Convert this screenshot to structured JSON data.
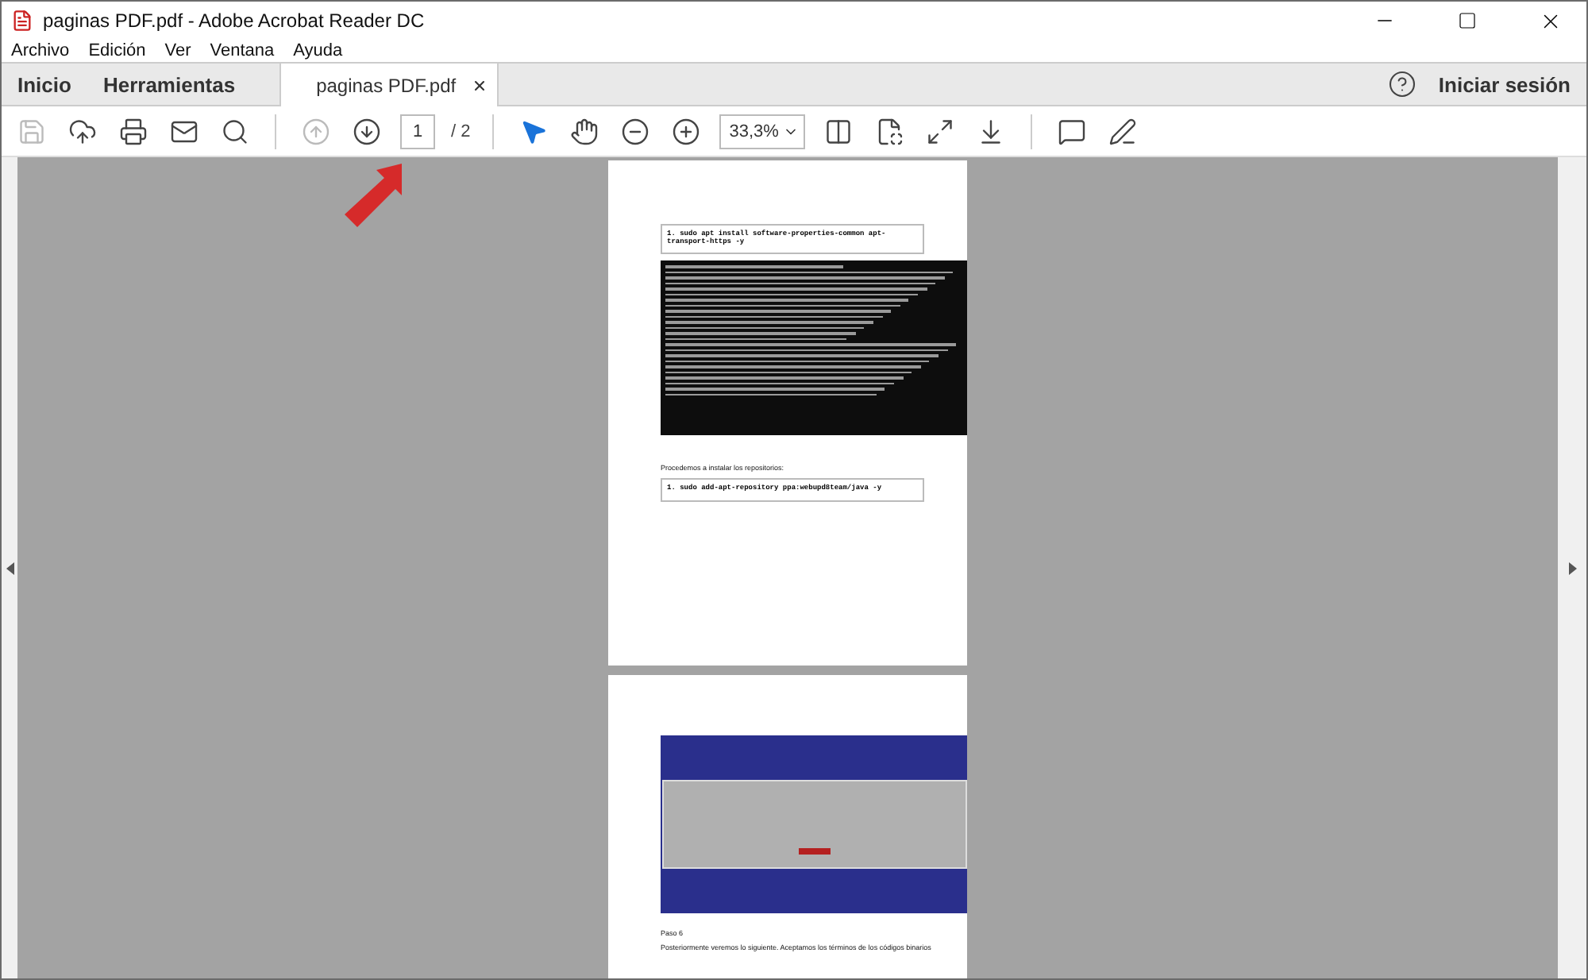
{
  "window": {
    "title": "paginas PDF.pdf - Adobe Acrobat Reader DC"
  },
  "menu": [
    "Archivo",
    "Edición",
    "Ver",
    "Ventana",
    "Ayuda"
  ],
  "nav_tabs": [
    {
      "label": "Inicio",
      "selected": false
    },
    {
      "label": "Herramientas",
      "selected": false
    }
  ],
  "doc_tab": {
    "label": "paginas PDF.pdf",
    "selected": true
  },
  "sign_in": "Iniciar sesión",
  "toolbar": {
    "group_1": [
      {
        "kind": "save",
        "disabled": true
      },
      {
        "kind": "upload",
        "disabled": false
      },
      {
        "kind": "print",
        "disabled": false
      },
      {
        "kind": "mail",
        "disabled": false
      },
      {
        "kind": "search",
        "disabled": false
      }
    ],
    "nav": [
      {
        "kind": "prev",
        "disabled": true
      },
      {
        "kind": "next",
        "disabled": false
      }
    ],
    "page_number": "1",
    "page_total": "/ 2",
    "tools": [
      {
        "kind": "select",
        "selected": true
      },
      {
        "kind": "hand",
        "selected": false
      }
    ],
    "zoom_buttons": [
      {
        "kind": "zoom-out"
      },
      {
        "kind": "zoom-in"
      }
    ],
    "zoom": "33,3%",
    "view": [
      {
        "kind": "fit"
      },
      {
        "kind": "rotate"
      },
      {
        "kind": "fullscreen"
      },
      {
        "kind": "scroll"
      }
    ],
    "annotate": [
      {
        "kind": "comment"
      },
      {
        "kind": "highlight"
      }
    ]
  },
  "pages": [
    {
      "blocks": [
        {
          "kind": "command",
          "text": "1. sudo apt install software-properties-common apt-transport-https -y"
        },
        {
          "kind": "terminal"
        },
        {
          "kind": "paragraph",
          "text": "Procedemos a instalar los repositorios:"
        },
        {
          "kind": "command",
          "text": "1. sudo add-apt-repository ppa:webupd8team/java -y"
        }
      ]
    },
    {
      "blocks": [
        {
          "kind": "installer"
        },
        {
          "kind": "paragraph",
          "text": "Paso 6"
        },
        {
          "kind": "paragraph",
          "text": "Posteriormente veremos lo siguiente. Aceptamos los términos de los códigos binarios"
        }
      ]
    }
  ]
}
